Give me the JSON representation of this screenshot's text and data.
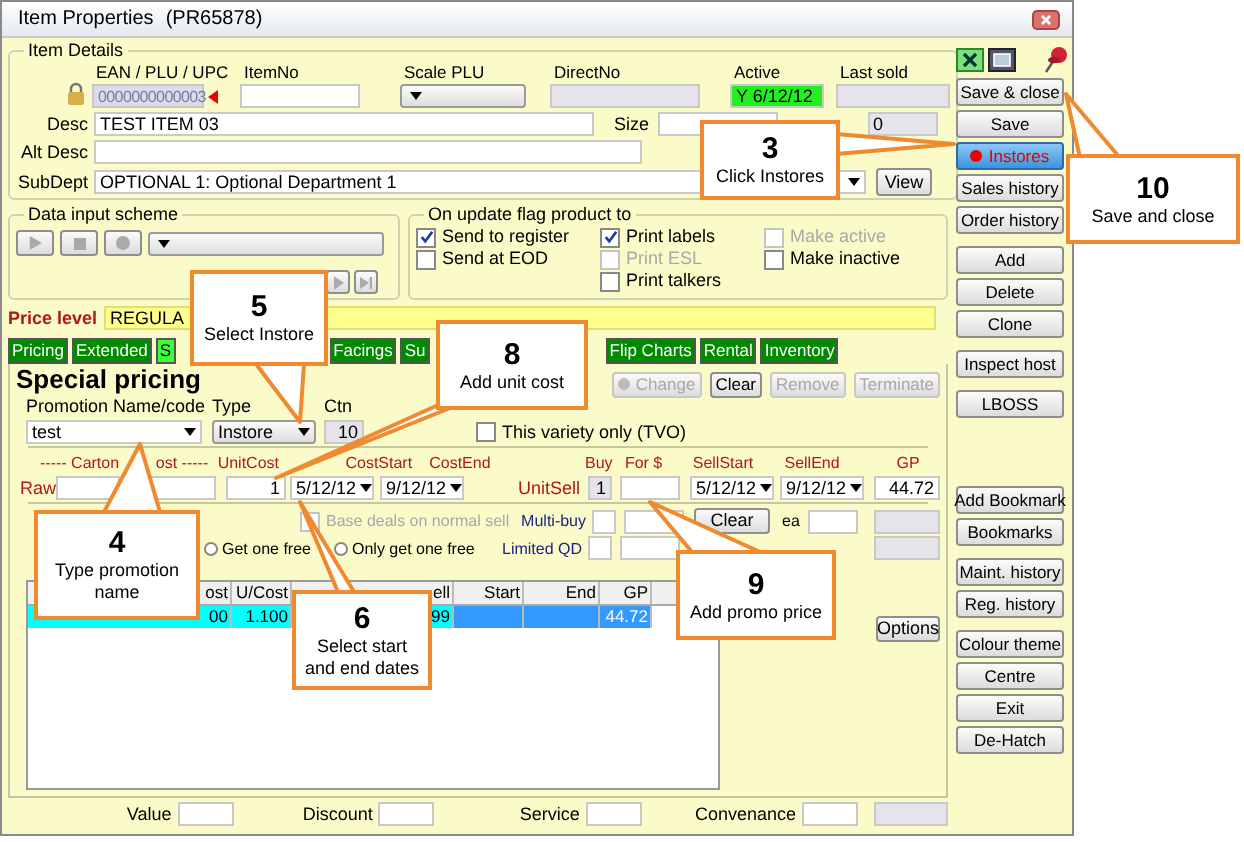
{
  "window": {
    "title": "Item Properties",
    "code": "(PR65878)"
  },
  "item_details": {
    "legend": "Item Details",
    "top_fields": [
      {
        "label": "EAN / PLU / UPC",
        "kind": "ean",
        "value": "0000000000003"
      },
      {
        "label": "ItemNo",
        "kind": "text"
      },
      {
        "label": "Scale PLU",
        "kind": "dropdown"
      },
      {
        "label": "DirectNo",
        "kind": "readonly"
      },
      {
        "label": "Active",
        "kind": "active",
        "value": "Y 6/12/12"
      },
      {
        "label": "Last sold",
        "kind": "readonly"
      }
    ],
    "desc": {
      "label": "Desc",
      "value": "TEST ITEM 03"
    },
    "size": {
      "label": "Size"
    },
    "unit_field": {
      "value": "0"
    },
    "alt_desc": {
      "label": "Alt Desc"
    },
    "subdept": {
      "label": "SubDept",
      "value": "OPTIONAL 1: Optional Department 1"
    },
    "view_button": "View"
  },
  "data_input_scheme": {
    "legend": "Data input scheme"
  },
  "update_flags": {
    "legend": "On update flag product to",
    "columns": [
      [
        {
          "label": "Send to register",
          "checked": true,
          "disabled": false
        },
        {
          "label": "Send at EOD",
          "checked": false,
          "disabled": false
        }
      ],
      [
        {
          "label": "Print labels",
          "checked": true,
          "disabled": false
        },
        {
          "label": "Print ESL",
          "checked": false,
          "disabled": true
        },
        {
          "label": "Print talkers",
          "checked": false,
          "disabled": false
        }
      ],
      [
        {
          "label": "Make active",
          "checked": false,
          "disabled": true
        },
        {
          "label": "Make inactive",
          "checked": false,
          "disabled": false
        }
      ]
    ]
  },
  "price_level": {
    "label": "Price level",
    "value": "REGULA"
  },
  "tabs": [
    {
      "label": "Pricing",
      "selected": false
    },
    {
      "label": "Extended",
      "selected": false
    },
    {
      "label": "S",
      "selected": true
    },
    {
      "label": "Facings",
      "selected": false
    },
    {
      "label": "Su",
      "selected": false
    },
    {
      "label": "Flip Charts",
      "selected": false
    },
    {
      "label": "Rental",
      "selected": false
    },
    {
      "label": "Inventory",
      "selected": false
    }
  ],
  "special_pricing": {
    "title": "Special pricing",
    "actions": [
      {
        "label": "Change",
        "disabled": true
      },
      {
        "label": "Clear",
        "disabled": false
      },
      {
        "label": "Remove",
        "disabled": true
      },
      {
        "label": "Terminate",
        "disabled": true
      }
    ],
    "promotion": {
      "label": "Promotion Name/code",
      "value": "test"
    },
    "type": {
      "label": "Type",
      "value": "Instore"
    },
    "ctn_qty": {
      "label": "Ctn",
      "value": "10"
    },
    "tvo": {
      "label": "This variety only (TVO)",
      "checked": false
    },
    "carton_cost": {
      "parts": [
        "----- Carton",
        "ost -----"
      ]
    },
    "raw": {
      "label": "Raw"
    },
    "unit_cost": {
      "label": "UnitCost",
      "value": "1"
    },
    "cost_start": {
      "label": "CostStart",
      "value": "5/12/12"
    },
    "cost_end": {
      "label": "CostEnd",
      "value": "9/12/12"
    },
    "unit_sell": {
      "label": "UnitSell"
    },
    "buy": {
      "label": "Buy",
      "value": "1"
    },
    "for_price": {
      "label": "For $"
    },
    "sell_start": {
      "label": "SellStart",
      "value": "5/12/12"
    },
    "sell_end": {
      "label": "SellEnd",
      "value": "9/12/12"
    },
    "gp": {
      "label": "GP",
      "value": "44.72"
    },
    "base_deals": {
      "label": "Base deals on normal sell",
      "checked": false,
      "disabled": true
    },
    "free_options": [
      {
        "label": "Get one free",
        "selected": false
      },
      {
        "label": "Only get one free",
        "selected": false
      }
    ],
    "multi_buy": {
      "label": "Multi-buy",
      "clear_button": "Clear",
      "unit": "ea"
    },
    "limited_qd": {
      "label": "Limited QD"
    },
    "table": {
      "columns": [
        "ost",
        "U/Cost",
        "ell",
        "Start",
        "End",
        "GP"
      ],
      "rows": [
        {
          "cells": [
            "00",
            "1.100",
            "99",
            null,
            null,
            "44.72"
          ],
          "selected": true
        }
      ]
    },
    "options_button": "Options"
  },
  "totals": [
    {
      "label": "Value"
    },
    {
      "label": "Discount"
    },
    {
      "label": "Service"
    },
    {
      "label": "Convenance"
    }
  ],
  "side_buttons": [
    [
      {
        "label": "Save & close",
        "highlighted": false
      },
      {
        "label": "Save",
        "highlighted": false
      },
      {
        "label": "Instores",
        "highlighted": true
      },
      {
        "label": "Sales history",
        "highlighted": false
      },
      {
        "label": "Order history",
        "highlighted": false
      }
    ],
    [
      {
        "label": "Add",
        "highlighted": false
      },
      {
        "label": "Delete",
        "highlighted": false
      },
      {
        "label": "Clone",
        "highlighted": false
      }
    ],
    [
      {
        "label": "Inspect host",
        "highlighted": false
      }
    ],
    [
      {
        "label": "LBOSS",
        "highlighted": false
      }
    ],
    [
      {
        "label": "Add Bookmark",
        "highlighted": false
      },
      {
        "label": "Bookmarks",
        "highlighted": false
      }
    ],
    [
      {
        "label": "Maint. history",
        "highlighted": false
      },
      {
        "label": "Reg. history",
        "highlighted": false
      }
    ],
    [
      {
        "label": "Colour theme",
        "highlighted": false
      },
      {
        "label": "Centre",
        "highlighted": false
      },
      {
        "label": "Exit",
        "highlighted": false
      },
      {
        "label": "De-Hatch",
        "highlighted": false
      }
    ]
  ],
  "callouts": [
    {
      "number": "3",
      "text": "Click Instores"
    },
    {
      "number": "10",
      "text": "Save and close"
    },
    {
      "number": "5",
      "text": "Select Instore"
    },
    {
      "number": "8",
      "text": "Add unit cost"
    },
    {
      "number": "4",
      "text": "Type promotion name"
    },
    {
      "number": "6",
      "text": "Select start and end dates"
    },
    {
      "number": "9",
      "text": "Add promo price"
    }
  ]
}
